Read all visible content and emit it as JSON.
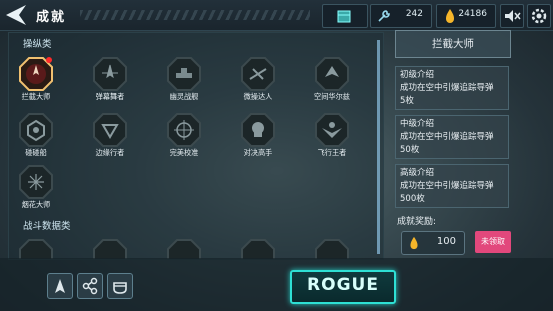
{
  "header": {
    "title": "成就",
    "resources": [
      {
        "name": "supply-crate",
        "value": ""
      },
      {
        "name": "wrench",
        "value": "242"
      },
      {
        "name": "gold-drop",
        "value": "24186"
      }
    ],
    "icons": [
      "mute-icon",
      "settings-icon"
    ]
  },
  "categories": [
    {
      "label": "操纵类"
    },
    {
      "label": "战斗数据类"
    }
  ],
  "achievements": [
    {
      "label": "拦截大师",
      "selected": true,
      "badge": "red-dot"
    },
    {
      "label": "弹幕舞者"
    },
    {
      "label": "幽灵战舰"
    },
    {
      "label": "微操达人"
    },
    {
      "label": "空间华尔兹"
    },
    {
      "label": "碰碰船"
    },
    {
      "label": "边缘行者"
    },
    {
      "label": "完美校准"
    },
    {
      "label": "对决高手"
    },
    {
      "label": "飞行王者"
    },
    {
      "label": "烟花大师"
    }
  ],
  "detail": {
    "title": "拦截大师",
    "levels": [
      {
        "name": "初级介绍",
        "desc": "成功在空中引爆追踪导弹",
        "amount": "5枚"
      },
      {
        "name": "中级介绍",
        "desc": "成功在空中引爆追踪导弹",
        "amount": "50枚"
      },
      {
        "name": "高级介绍",
        "desc": "成功在空中引爆追踪导弹",
        "amount": "500枚"
      }
    ],
    "reward_label": "成就奖励:",
    "reward_value": "100",
    "claim_label": "未领取"
  },
  "bottom": {
    "rogue_label": "ROGUE",
    "buttons": [
      "ship-icon",
      "share-icon",
      "helmet-icon"
    ]
  },
  "colors": {
    "accent": "#2ee0d4",
    "claim": "#e2487c",
    "gold": "#f5b52a"
  }
}
